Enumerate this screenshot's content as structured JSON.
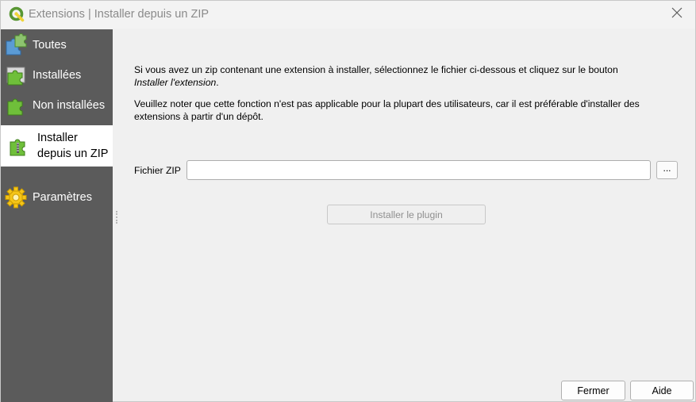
{
  "window": {
    "title": "Extensions | Installer depuis un ZIP",
    "app_icon": "qgis-logo-icon",
    "close_icon": "close-icon"
  },
  "sidebar": {
    "items": [
      {
        "label": "Toutes",
        "icon": "puzzle-blue-icon",
        "active": false
      },
      {
        "label": "Installées",
        "icon": "puzzle-installed-icon",
        "active": false
      },
      {
        "label": "Non installées",
        "icon": "puzzle-green-icon",
        "active": false
      },
      {
        "label": "Installer depuis un ZIP",
        "label_line1": "Installer",
        "label_line2": "depuis un ZIP",
        "icon": "puzzle-zip-icon",
        "active": true
      },
      {
        "label": "Paramètres",
        "icon": "gear-icon",
        "active": false
      }
    ]
  },
  "main": {
    "intro_text": "Si vous avez un zip contenant une extension à installer, sélectionnez le fichier ci-dessous et cliquez sur le bouton",
    "intro_emphasis": "Installer l'extension",
    "intro_end": ".",
    "note_text": "Veuillez noter que cette fonction n'est pas applicable pour la plupart des utilisateurs, car il est préférable d'installer des extensions à partir d'un dépôt.",
    "zip_label": "Fichier ZIP",
    "zip_value": "",
    "browse_label": "...",
    "install_label": "Installer le plugin"
  },
  "footer": {
    "close_label": "Fermer",
    "help_label": "Aide"
  },
  "colors": {
    "sidebar_bg": "#5b5b5b",
    "window_bg": "#f0f0f0",
    "active_item_bg": "#ffffff",
    "qgis_green": "#589632",
    "qgis_yellow": "#f0d437"
  }
}
